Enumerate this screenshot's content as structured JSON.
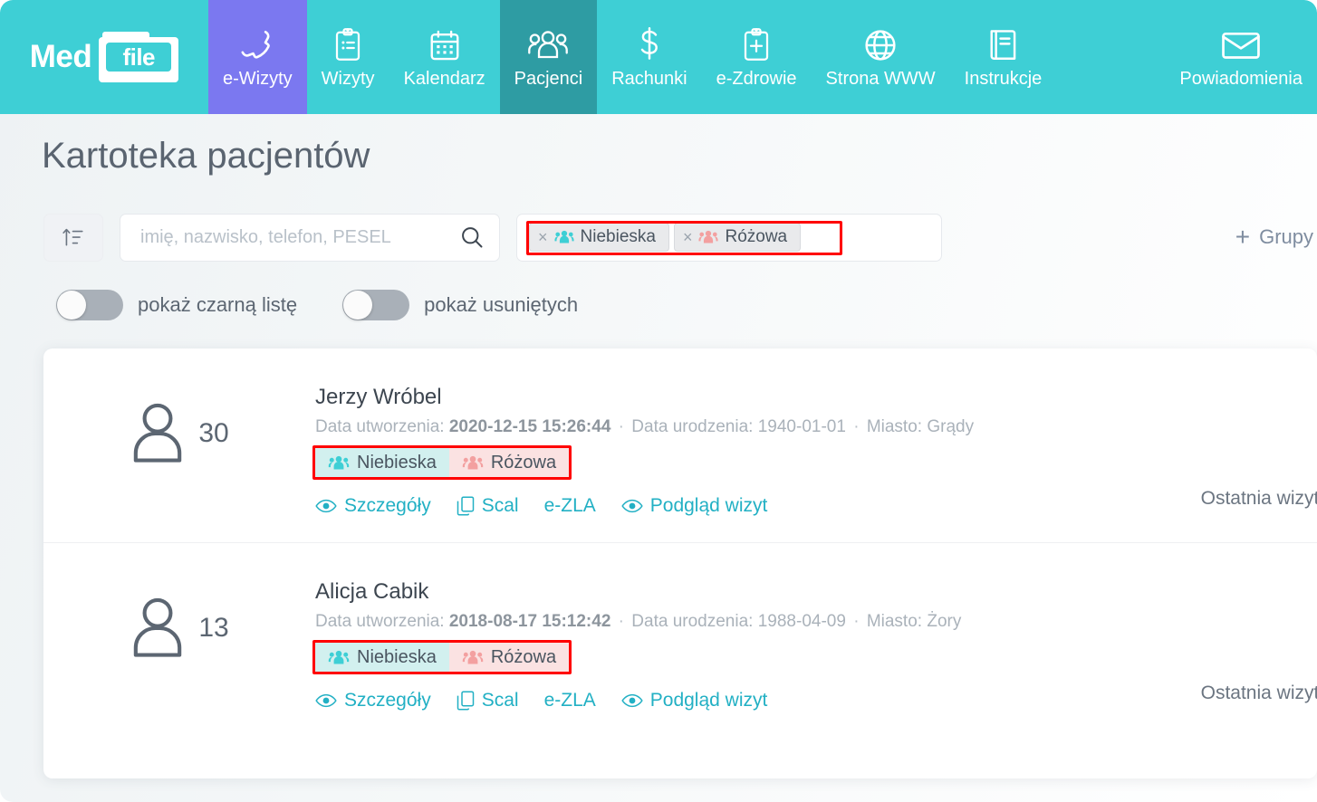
{
  "brand": {
    "name_left": "Med",
    "name_right": "file"
  },
  "nav": {
    "items": [
      {
        "label": "e-Wizyty",
        "icon": "phone-icon",
        "state": "accent"
      },
      {
        "label": "Wizyty",
        "icon": "clipboard-icon",
        "state": "normal"
      },
      {
        "label": "Kalendarz",
        "icon": "calendar-icon",
        "state": "normal"
      },
      {
        "label": "Pacjenci",
        "icon": "people-icon",
        "state": "active"
      },
      {
        "label": "Rachunki",
        "icon": "dollar-icon",
        "state": "normal"
      },
      {
        "label": "e-Zdrowie",
        "icon": "clipboard-plus-icon",
        "state": "normal"
      },
      {
        "label": "Strona WWW",
        "icon": "globe-icon",
        "state": "normal"
      },
      {
        "label": "Instrukcje",
        "icon": "book-icon",
        "state": "normal"
      },
      {
        "label": "Powiadomienia",
        "icon": "envelope-icon",
        "state": "normal"
      }
    ]
  },
  "page": {
    "title": "Kartoteka pacjentów"
  },
  "filters": {
    "sort_icon": "sort-ascending-icon",
    "search": {
      "placeholder": "imię, nazwisko, telefon, PESEL",
      "value": "",
      "icon": "search-icon"
    },
    "tag_chips": [
      {
        "label": "Niebieska",
        "remove": "×",
        "icon": "people-icon",
        "color": "#3ecfd5"
      },
      {
        "label": "Różowa",
        "remove": "×",
        "icon": "people-icon",
        "color": "#f3a0a0"
      }
    ],
    "groups_button": {
      "label": "Grupy",
      "plus": "+"
    }
  },
  "toggles": [
    {
      "label": "pokaż czarną listę",
      "on": false
    },
    {
      "label": "pokaż usuniętych",
      "on": false
    }
  ],
  "patients": [
    {
      "count": "30",
      "name": "Jerzy Wróbel",
      "created_label": "Data utworzenia:",
      "created_value": "2020-12-15 15:26:44",
      "birth_label": "Data urodzenia:",
      "birth_value": "1940-01-01",
      "city_label": "Miasto:",
      "city_value": "Grądy",
      "tags": [
        {
          "label": "Niebieska",
          "class": "blue",
          "icon": "people-icon"
        },
        {
          "label": "Różowa",
          "class": "pink",
          "icon": "people-icon"
        }
      ],
      "actions": [
        {
          "label": "Szczegóły",
          "icon": "eye-icon"
        },
        {
          "label": "Scal",
          "icon": "copy-icon"
        },
        {
          "label": "e-ZLA",
          "icon": "none"
        },
        {
          "label": "Podgląd wizyt",
          "icon": "eye-icon"
        }
      ],
      "last_visit": "Ostatnia wizyta"
    },
    {
      "count": "13",
      "name": "Alicja Cabik",
      "created_label": "Data utworzenia:",
      "created_value": "2018-08-17 15:12:42",
      "birth_label": "Data urodzenia:",
      "birth_value": "1988-04-09",
      "city_label": "Miasto:",
      "city_value": "Żory",
      "tags": [
        {
          "label": "Niebieska",
          "class": "blue",
          "icon": "people-icon"
        },
        {
          "label": "Różowa",
          "class": "pink",
          "icon": "people-icon"
        }
      ],
      "actions": [
        {
          "label": "Szczegóły",
          "icon": "eye-icon"
        },
        {
          "label": "Scal",
          "icon": "copy-icon"
        },
        {
          "label": "e-ZLA",
          "icon": "none"
        },
        {
          "label": "Podgląd wizyt",
          "icon": "eye-icon"
        }
      ],
      "last_visit": "Ostatnia wizyta"
    }
  ],
  "colors": {
    "brand_teal": "#3ecfd5",
    "active_tab": "#2e9ca3",
    "accent_purple": "#7b78f0",
    "link_teal": "#22b0c4",
    "highlight_red": "#ff0000",
    "tag_blue_bg": "#d2f0ef",
    "tag_pink_bg": "#fbe2e2"
  }
}
